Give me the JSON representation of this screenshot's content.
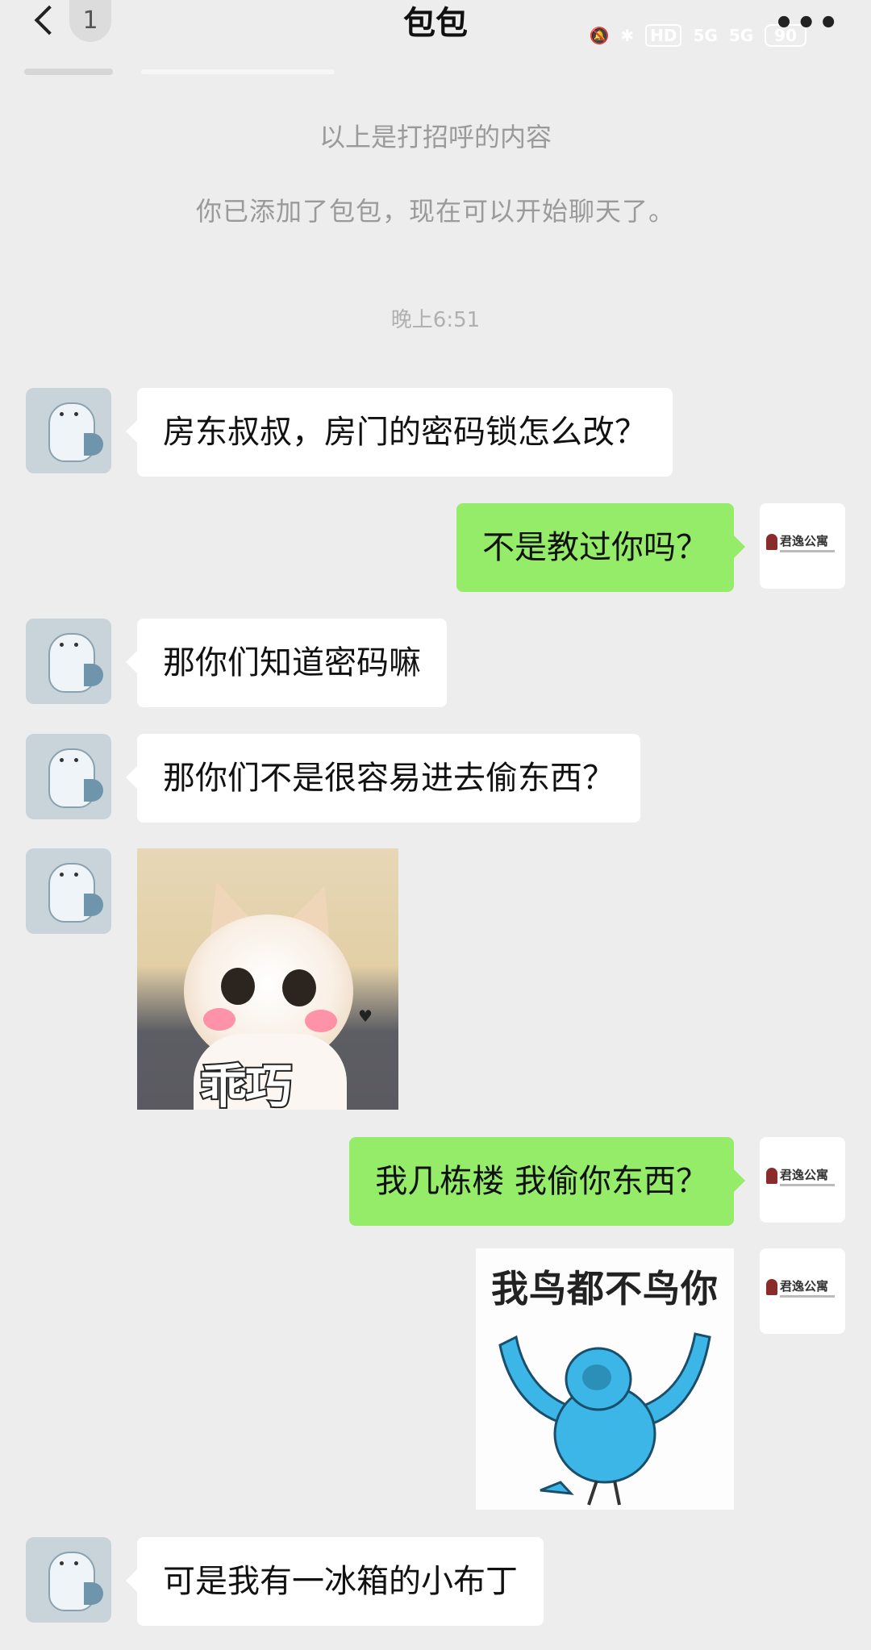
{
  "header": {
    "back_label": "<",
    "unread_count": "1",
    "title": "包包",
    "more_label": "•••",
    "status": {
      "hd": "HD",
      "net1": "5G",
      "net2": "5G",
      "battery": "90"
    }
  },
  "system_messages": {
    "greeting_note": "以上是打招呼的内容",
    "added_note": "你已添加了包包，现在可以开始聊天了。",
    "timestamp": "晚上6:51"
  },
  "messages": [
    {
      "side": "in",
      "text": "房东叔叔，房门的密码锁怎么改？"
    },
    {
      "side": "out",
      "text": "不是教过你吗？"
    },
    {
      "side": "in",
      "text": "那你们知道密码嘛"
    },
    {
      "side": "in",
      "text": "那你们不是很容易进去偷东西？"
    },
    {
      "side": "in",
      "type": "sticker",
      "sticker": "cat",
      "caption": "乖巧"
    },
    {
      "side": "out",
      "text": "我几栋楼 我偷你东西？"
    },
    {
      "side": "out",
      "type": "sticker",
      "sticker": "blue-bird",
      "caption": "我鸟都不鸟你"
    },
    {
      "side": "in",
      "text": "可是我有一冰箱的小布丁"
    }
  ],
  "my_avatar": {
    "brand": "君逸公寓"
  }
}
